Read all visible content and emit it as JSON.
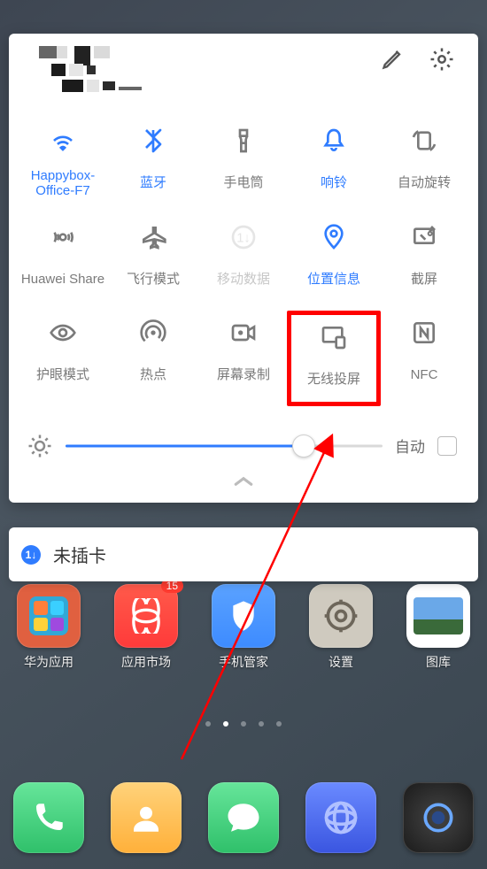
{
  "status": {
    "carrier": "未插卡",
    "bt_icon": true,
    "battery": true
  },
  "panel": {
    "edit_icon": "pencil",
    "settings_icon": "gear",
    "tiles": [
      {
        "id": "wifi",
        "label": "Happybox-Office-F7",
        "state": "active"
      },
      {
        "id": "bluetooth",
        "label": "蓝牙",
        "state": "active"
      },
      {
        "id": "flashlight",
        "label": "手电筒",
        "state": "normal"
      },
      {
        "id": "ring",
        "label": "响铃",
        "state": "active"
      },
      {
        "id": "autorotate",
        "label": "自动旋转",
        "state": "normal"
      },
      {
        "id": "huaweishare",
        "label": "Huawei Share",
        "state": "normal"
      },
      {
        "id": "airplane",
        "label": "飞行模式",
        "state": "normal"
      },
      {
        "id": "mobiledata",
        "label": "移动数据",
        "state": "disabled"
      },
      {
        "id": "location",
        "label": "位置信息",
        "state": "active"
      },
      {
        "id": "screenshot",
        "label": "截屏",
        "state": "normal"
      },
      {
        "id": "eyecomfort",
        "label": "护眼模式",
        "state": "normal"
      },
      {
        "id": "hotspot",
        "label": "热点",
        "state": "normal"
      },
      {
        "id": "screenrecord",
        "label": "屏幕录制",
        "state": "normal"
      },
      {
        "id": "wirelesscast",
        "label": "无线投屏",
        "state": "normal",
        "highlighted": true
      },
      {
        "id": "nfc",
        "label": "NFC",
        "state": "normal"
      }
    ],
    "brightness": {
      "value_pct": 75,
      "auto_label": "自动",
      "auto_checked": false
    }
  },
  "notification": {
    "text": "未插卡"
  },
  "home": {
    "apps": [
      {
        "id": "huaweiapps",
        "label": "华为应用",
        "bg": "#e06040"
      },
      {
        "id": "appmarket",
        "label": "应用市场",
        "bg": "#ff3a3a",
        "badge": "15"
      },
      {
        "id": "phonemanager",
        "label": "手机管家",
        "bg": "#3d8bff"
      },
      {
        "id": "settings",
        "label": "设置",
        "bg": "#c9c4b8"
      },
      {
        "id": "gallery",
        "label": "图库",
        "bg": "#e6e6e6"
      }
    ],
    "dock": [
      {
        "id": "phone",
        "bg": "#39d27a"
      },
      {
        "id": "contacts",
        "bg": "#ffbb3a"
      },
      {
        "id": "messages",
        "bg": "#3fd070"
      },
      {
        "id": "browser",
        "bg": "#4a6cff"
      },
      {
        "id": "camera",
        "bg": "#2a2a2a"
      }
    ]
  }
}
